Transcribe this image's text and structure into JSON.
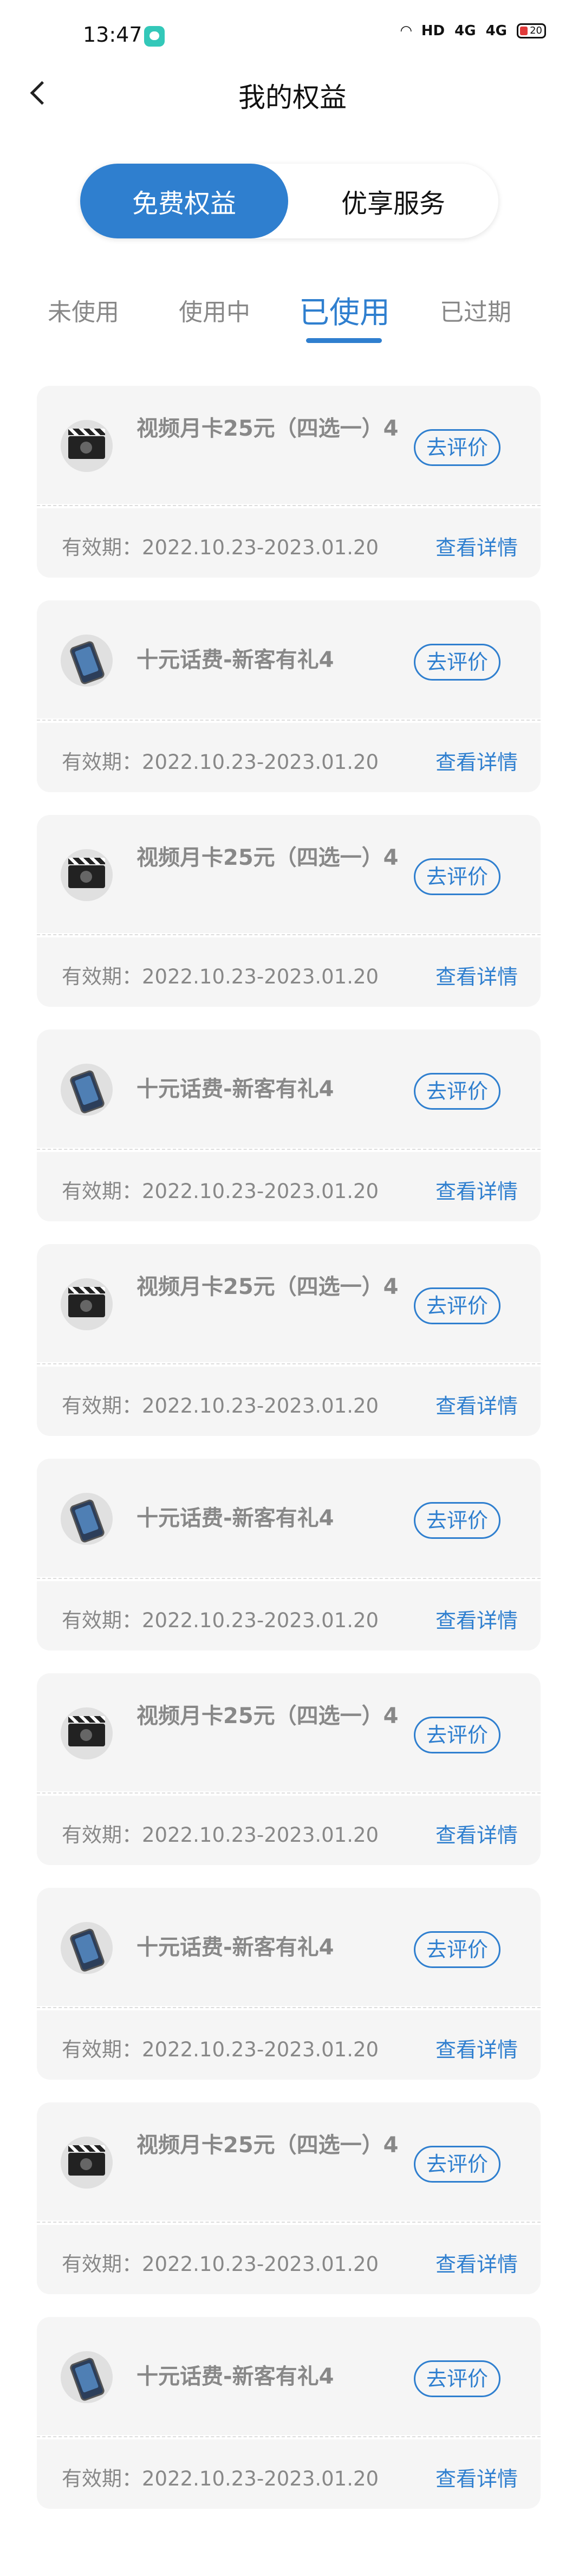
{
  "status": {
    "time": "13:47",
    "hd": "HD",
    "signal1": "4G",
    "signal2": "4G",
    "battery": "20"
  },
  "header": {
    "title": "我的权益"
  },
  "segment": {
    "free": "免费权益",
    "vip": "优享服务"
  },
  "tabs": [
    "未使用",
    "使用中",
    "已使用",
    "已过期"
  ],
  "active_tab_index": 2,
  "validity_label": "有效期：",
  "rate_label": "去评价",
  "detail_label": "查看详情",
  "items": [
    {
      "name": "视频月卡25元（四选一）4",
      "icon": "film-clapper-icon",
      "validity": "2022.10.23-2023.01.20"
    },
    {
      "name": "十元话费-新客有礼4",
      "icon": "phone-icon",
      "validity": "2022.10.23-2023.01.20"
    },
    {
      "name": "视频月卡25元（四选一）4",
      "icon": "film-clapper-icon",
      "validity": "2022.10.23-2023.01.20"
    },
    {
      "name": "十元话费-新客有礼4",
      "icon": "phone-icon",
      "validity": "2022.10.23-2023.01.20"
    },
    {
      "name": "视频月卡25元（四选一）4",
      "icon": "film-clapper-icon",
      "validity": "2022.10.23-2023.01.20"
    },
    {
      "name": "十元话费-新客有礼4",
      "icon": "phone-icon",
      "validity": "2022.10.23-2023.01.20"
    },
    {
      "name": "视频月卡25元（四选一）4",
      "icon": "film-clapper-icon",
      "validity": "2022.10.23-2023.01.20"
    },
    {
      "name": "十元话费-新客有礼4",
      "icon": "phone-icon",
      "validity": "2022.10.23-2023.01.20"
    },
    {
      "name": "视频月卡25元（四选一）4",
      "icon": "film-clapper-icon",
      "validity": "2022.10.23-2023.01.20"
    },
    {
      "name": "十元话费-新客有礼4",
      "icon": "phone-icon",
      "validity": "2022.10.23-2023.01.20"
    }
  ],
  "colors": {
    "accent": "#2f7fcf",
    "card_bg": "#f5f5f5",
    "muted_text": "#888888"
  }
}
